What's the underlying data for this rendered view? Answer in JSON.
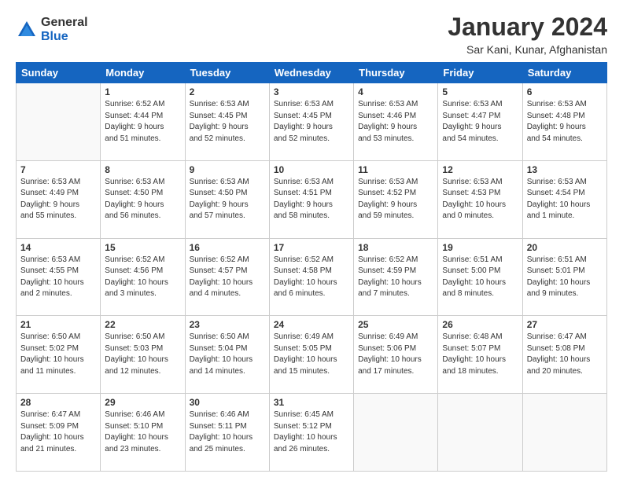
{
  "logo": {
    "general": "General",
    "blue": "Blue"
  },
  "header": {
    "title": "January 2024",
    "subtitle": "Sar Kani, Kunar, Afghanistan"
  },
  "weekdays": [
    "Sunday",
    "Monday",
    "Tuesday",
    "Wednesday",
    "Thursday",
    "Friday",
    "Saturday"
  ],
  "weeks": [
    [
      {
        "day": "",
        "info": ""
      },
      {
        "day": "1",
        "info": "Sunrise: 6:52 AM\nSunset: 4:44 PM\nDaylight: 9 hours\nand 51 minutes."
      },
      {
        "day": "2",
        "info": "Sunrise: 6:53 AM\nSunset: 4:45 PM\nDaylight: 9 hours\nand 52 minutes."
      },
      {
        "day": "3",
        "info": "Sunrise: 6:53 AM\nSunset: 4:45 PM\nDaylight: 9 hours\nand 52 minutes."
      },
      {
        "day": "4",
        "info": "Sunrise: 6:53 AM\nSunset: 4:46 PM\nDaylight: 9 hours\nand 53 minutes."
      },
      {
        "day": "5",
        "info": "Sunrise: 6:53 AM\nSunset: 4:47 PM\nDaylight: 9 hours\nand 54 minutes."
      },
      {
        "day": "6",
        "info": "Sunrise: 6:53 AM\nSunset: 4:48 PM\nDaylight: 9 hours\nand 54 minutes."
      }
    ],
    [
      {
        "day": "7",
        "info": "Sunrise: 6:53 AM\nSunset: 4:49 PM\nDaylight: 9 hours\nand 55 minutes."
      },
      {
        "day": "8",
        "info": "Sunrise: 6:53 AM\nSunset: 4:50 PM\nDaylight: 9 hours\nand 56 minutes."
      },
      {
        "day": "9",
        "info": "Sunrise: 6:53 AM\nSunset: 4:50 PM\nDaylight: 9 hours\nand 57 minutes."
      },
      {
        "day": "10",
        "info": "Sunrise: 6:53 AM\nSunset: 4:51 PM\nDaylight: 9 hours\nand 58 minutes."
      },
      {
        "day": "11",
        "info": "Sunrise: 6:53 AM\nSunset: 4:52 PM\nDaylight: 9 hours\nand 59 minutes."
      },
      {
        "day": "12",
        "info": "Sunrise: 6:53 AM\nSunset: 4:53 PM\nDaylight: 10 hours\nand 0 minutes."
      },
      {
        "day": "13",
        "info": "Sunrise: 6:53 AM\nSunset: 4:54 PM\nDaylight: 10 hours\nand 1 minute."
      }
    ],
    [
      {
        "day": "14",
        "info": "Sunrise: 6:53 AM\nSunset: 4:55 PM\nDaylight: 10 hours\nand 2 minutes."
      },
      {
        "day": "15",
        "info": "Sunrise: 6:52 AM\nSunset: 4:56 PM\nDaylight: 10 hours\nand 3 minutes."
      },
      {
        "day": "16",
        "info": "Sunrise: 6:52 AM\nSunset: 4:57 PM\nDaylight: 10 hours\nand 4 minutes."
      },
      {
        "day": "17",
        "info": "Sunrise: 6:52 AM\nSunset: 4:58 PM\nDaylight: 10 hours\nand 6 minutes."
      },
      {
        "day": "18",
        "info": "Sunrise: 6:52 AM\nSunset: 4:59 PM\nDaylight: 10 hours\nand 7 minutes."
      },
      {
        "day": "19",
        "info": "Sunrise: 6:51 AM\nSunset: 5:00 PM\nDaylight: 10 hours\nand 8 minutes."
      },
      {
        "day": "20",
        "info": "Sunrise: 6:51 AM\nSunset: 5:01 PM\nDaylight: 10 hours\nand 9 minutes."
      }
    ],
    [
      {
        "day": "21",
        "info": "Sunrise: 6:50 AM\nSunset: 5:02 PM\nDaylight: 10 hours\nand 11 minutes."
      },
      {
        "day": "22",
        "info": "Sunrise: 6:50 AM\nSunset: 5:03 PM\nDaylight: 10 hours\nand 12 minutes."
      },
      {
        "day": "23",
        "info": "Sunrise: 6:50 AM\nSunset: 5:04 PM\nDaylight: 10 hours\nand 14 minutes."
      },
      {
        "day": "24",
        "info": "Sunrise: 6:49 AM\nSunset: 5:05 PM\nDaylight: 10 hours\nand 15 minutes."
      },
      {
        "day": "25",
        "info": "Sunrise: 6:49 AM\nSunset: 5:06 PM\nDaylight: 10 hours\nand 17 minutes."
      },
      {
        "day": "26",
        "info": "Sunrise: 6:48 AM\nSunset: 5:07 PM\nDaylight: 10 hours\nand 18 minutes."
      },
      {
        "day": "27",
        "info": "Sunrise: 6:47 AM\nSunset: 5:08 PM\nDaylight: 10 hours\nand 20 minutes."
      }
    ],
    [
      {
        "day": "28",
        "info": "Sunrise: 6:47 AM\nSunset: 5:09 PM\nDaylight: 10 hours\nand 21 minutes."
      },
      {
        "day": "29",
        "info": "Sunrise: 6:46 AM\nSunset: 5:10 PM\nDaylight: 10 hours\nand 23 minutes."
      },
      {
        "day": "30",
        "info": "Sunrise: 6:46 AM\nSunset: 5:11 PM\nDaylight: 10 hours\nand 25 minutes."
      },
      {
        "day": "31",
        "info": "Sunrise: 6:45 AM\nSunset: 5:12 PM\nDaylight: 10 hours\nand 26 minutes."
      },
      {
        "day": "",
        "info": ""
      },
      {
        "day": "",
        "info": ""
      },
      {
        "day": "",
        "info": ""
      }
    ]
  ]
}
